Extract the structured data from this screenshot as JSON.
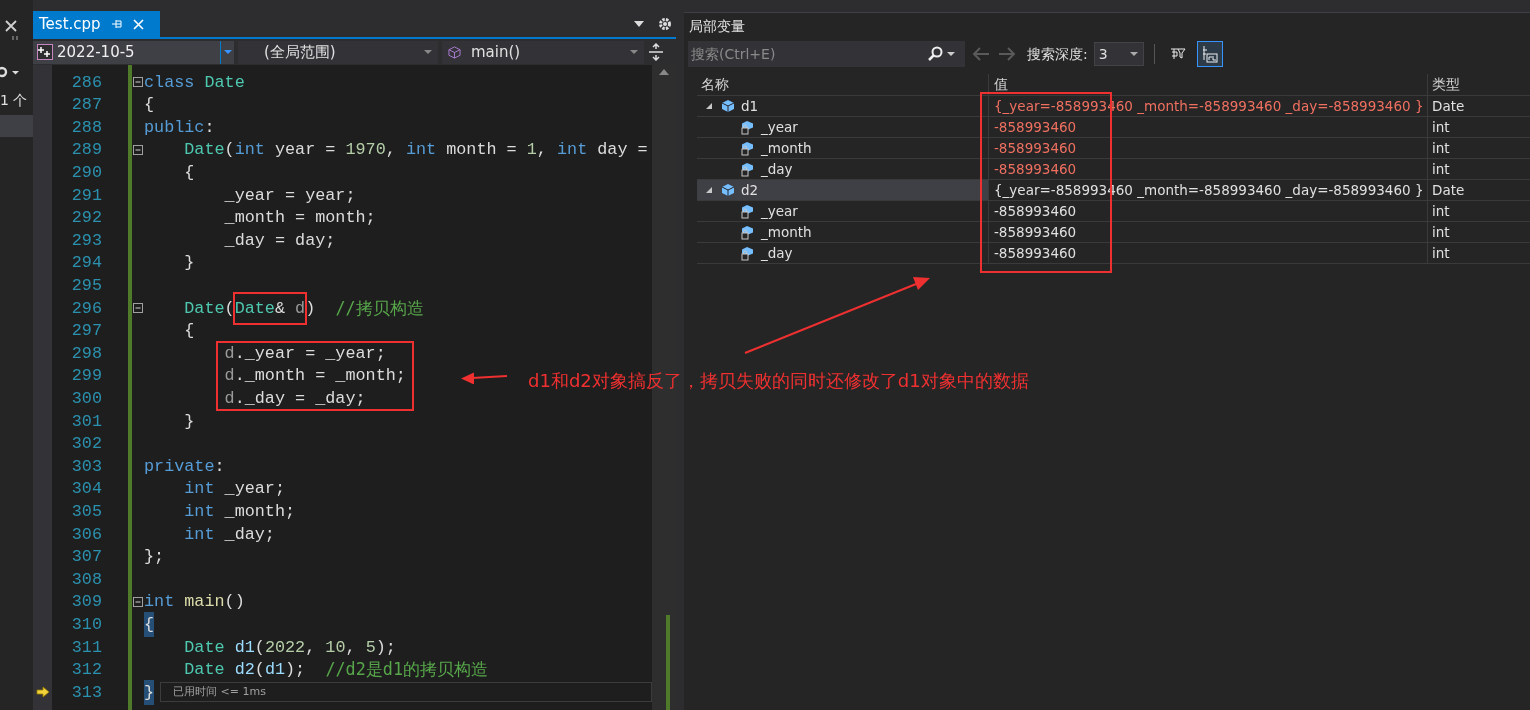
{
  "left_panel": {
    "count_text": "1 个"
  },
  "editor": {
    "tab": {
      "label": "Test.cpp",
      "selected": true
    },
    "nav": {
      "project": "2022-10-5",
      "scope": "(全局范围)",
      "member": "main()"
    },
    "lines": [
      {
        "number": "286",
        "fold": true,
        "current": false,
        "tokens": [
          {
            "kind": "kw",
            "text": "class"
          },
          {
            "kind": "type",
            "text": " Date"
          }
        ]
      },
      {
        "number": "287",
        "fold": false,
        "current": false,
        "tokens": [
          {
            "kind": "plain",
            "text": "{"
          }
        ]
      },
      {
        "number": "288",
        "fold": false,
        "current": false,
        "tokens": [
          {
            "kind": "kw",
            "text": "public"
          },
          {
            "kind": "plain",
            "text": ":"
          }
        ]
      },
      {
        "number": "289",
        "fold": true,
        "current": false,
        "tokens": [
          {
            "kind": "type",
            "text": "    Date"
          },
          {
            "kind": "plain",
            "text": "("
          },
          {
            "kind": "kw",
            "text": "int"
          },
          {
            "kind": "plain",
            "text": " year = "
          },
          {
            "kind": "num",
            "text": "1970"
          },
          {
            "kind": "plain",
            "text": ", "
          },
          {
            "kind": "kw",
            "text": "int"
          },
          {
            "kind": "plain",
            "text": " month = "
          },
          {
            "kind": "num",
            "text": "1"
          },
          {
            "kind": "plain",
            "text": ", "
          },
          {
            "kind": "kw",
            "text": "int"
          },
          {
            "kind": "plain",
            "text": " day ="
          }
        ]
      },
      {
        "number": "290",
        "fold": false,
        "current": false,
        "tokens": [
          {
            "kind": "plain",
            "text": "    {"
          }
        ]
      },
      {
        "number": "291",
        "fold": false,
        "current": false,
        "tokens": [
          {
            "kind": "plain",
            "text": "        _year = year;"
          }
        ]
      },
      {
        "number": "292",
        "fold": false,
        "current": false,
        "tokens": [
          {
            "kind": "plain",
            "text": "        _month = month;"
          }
        ]
      },
      {
        "number": "293",
        "fold": false,
        "current": false,
        "tokens": [
          {
            "kind": "plain",
            "text": "        _day = day;"
          }
        ]
      },
      {
        "number": "294",
        "fold": false,
        "current": false,
        "tokens": [
          {
            "kind": "plain",
            "text": "    }"
          }
        ]
      },
      {
        "number": "295",
        "fold": false,
        "current": false
      },
      {
        "number": "296",
        "fold": true,
        "current": false,
        "tokens": [
          {
            "kind": "type",
            "text": "    Date",
            "framed": false
          },
          {
            "kind": "plain",
            "text": "(",
            "framed": false
          },
          {
            "kind": "type",
            "text": "Date",
            "framed": true
          },
          {
            "kind": "plain",
            "text": "& ",
            "framed": true
          },
          {
            "kind": "param",
            "text": "d",
            "framed": true
          },
          {
            "kind": "plain",
            "text": ")",
            "framed": false
          },
          {
            "kind": "comment",
            "text": "  //拷贝构造",
            "framed": false
          }
        ]
      },
      {
        "number": "297",
        "fold": false,
        "current": false,
        "tokens": [
          {
            "kind": "plain",
            "text": "    {"
          }
        ]
      },
      {
        "number": "298",
        "fold": false,
        "current": false,
        "tokens": [
          {
            "kind": "param",
            "text": "        d"
          },
          {
            "kind": "plain",
            "text": "._year = _year;"
          }
        ]
      },
      {
        "number": "299",
        "fold": false,
        "current": false,
        "tokens": [
          {
            "kind": "param",
            "text": "        d"
          },
          {
            "kind": "plain",
            "text": "._month = _month;"
          }
        ]
      },
      {
        "number": "300",
        "fold": false,
        "current": false,
        "tokens": [
          {
            "kind": "param",
            "text": "        d"
          },
          {
            "kind": "plain",
            "text": "._day = _day;"
          }
        ]
      },
      {
        "number": "301",
        "fold": false,
        "current": false,
        "tokens": [
          {
            "kind": "plain",
            "text": "    }"
          }
        ]
      },
      {
        "number": "302",
        "fold": false,
        "current": false
      },
      {
        "number": "303",
        "fold": false,
        "current": false,
        "tokens": [
          {
            "kind": "kw",
            "text": "private"
          },
          {
            "kind": "plain",
            "text": ":"
          }
        ]
      },
      {
        "number": "304",
        "fold": false,
        "current": false,
        "tokens": [
          {
            "kind": "kw",
            "text": "    int"
          },
          {
            "kind": "plain",
            "text": " _year;"
          }
        ]
      },
      {
        "number": "305",
        "fold": false,
        "current": false,
        "tokens": [
          {
            "kind": "kw",
            "text": "    int"
          },
          {
            "kind": "plain",
            "text": " _month;"
          }
        ]
      },
      {
        "number": "306",
        "fold": false,
        "current": false,
        "tokens": [
          {
            "kind": "kw",
            "text": "    int"
          },
          {
            "kind": "plain",
            "text": " _day;"
          }
        ]
      },
      {
        "number": "307",
        "fold": false,
        "current": false,
        "tokens": [
          {
            "kind": "plain",
            "text": "};"
          }
        ]
      },
      {
        "number": "308",
        "fold": false,
        "current": false
      },
      {
        "number": "309",
        "fold": true,
        "current": false,
        "tokens": [
          {
            "kind": "kw",
            "text": "int"
          },
          {
            "kind": "func",
            "text": " main"
          },
          {
            "kind": "plain",
            "text": "()"
          }
        ]
      },
      {
        "number": "310",
        "fold": false,
        "current": false,
        "tokens": [
          {
            "kind": "brace_match",
            "text": "{"
          }
        ]
      },
      {
        "number": "311",
        "fold": false,
        "current": false,
        "tokens": [
          {
            "kind": "type",
            "text": "    Date"
          },
          {
            "kind": "local",
            "text": " d1"
          },
          {
            "kind": "plain",
            "text": "("
          },
          {
            "kind": "num",
            "text": "2022"
          },
          {
            "kind": "plain",
            "text": ", "
          },
          {
            "kind": "num",
            "text": "10"
          },
          {
            "kind": "plain",
            "text": ", "
          },
          {
            "kind": "num",
            "text": "5"
          },
          {
            "kind": "plain",
            "text": ");"
          }
        ]
      },
      {
        "number": "312",
        "fold": false,
        "current": false,
        "tokens": [
          {
            "kind": "type",
            "text": "    Date"
          },
          {
            "kind": "local",
            "text": " d2"
          },
          {
            "kind": "plain",
            "text": "("
          },
          {
            "kind": "local",
            "text": "d1"
          },
          {
            "kind": "plain",
            "text": ");"
          },
          {
            "kind": "comment",
            "text": "  //d2是d1的拷贝构造"
          }
        ]
      },
      {
        "number": "313",
        "fold": false,
        "current": true,
        "tokens": [
          {
            "kind": "brace_match",
            "text": "}"
          }
        ],
        "hint": "已用时间 <= 1ms"
      }
    ]
  },
  "locals": {
    "title": "局部变量",
    "search": {
      "placeholder": "搜索(Ctrl+E)"
    },
    "history_buttons": [
      {
        "kind": "back",
        "disabled": true
      },
      {
        "kind": "forward",
        "disabled": true
      }
    ],
    "depth_label": "搜索深度:",
    "depth_value": "3",
    "toggles": [
      {
        "kind": "pin_filter",
        "selected": false
      },
      {
        "kind": "ab_view",
        "selected": true
      }
    ],
    "columns": [
      "名称",
      "值",
      "类型"
    ],
    "rows": [
      {
        "name": "d1",
        "value": "{_year=-858993460 _month=-858993460 _day=-858993460 }",
        "type": "Date",
        "changed": true,
        "expanded": true,
        "selected": false,
        "children": [
          {
            "name": "_year",
            "value": "-858993460",
            "type": "int",
            "changed": true,
            "selected": false
          },
          {
            "name": "_month",
            "value": "-858993460",
            "type": "int",
            "changed": true,
            "selected": false
          },
          {
            "name": "_day",
            "value": "-858993460",
            "type": "int",
            "changed": true,
            "selected": false
          }
        ]
      },
      {
        "name": "d2",
        "value": "{_year=-858993460 _month=-858993460 _day=-858993460 }",
        "type": "Date",
        "changed": false,
        "expanded": true,
        "selected": true,
        "children": [
          {
            "name": "_year",
            "value": "-858993460",
            "type": "int",
            "changed": false,
            "selected": false
          },
          {
            "name": "_month",
            "value": "-858993460",
            "type": "int",
            "changed": false,
            "selected": false
          },
          {
            "name": "_day",
            "value": "-858993460",
            "type": "int",
            "changed": false,
            "selected": false
          }
        ]
      }
    ]
  },
  "annotation": {
    "text": "d1和d2对象搞反了，拷贝失败的同时还修改了d1对象中的数据"
  }
}
